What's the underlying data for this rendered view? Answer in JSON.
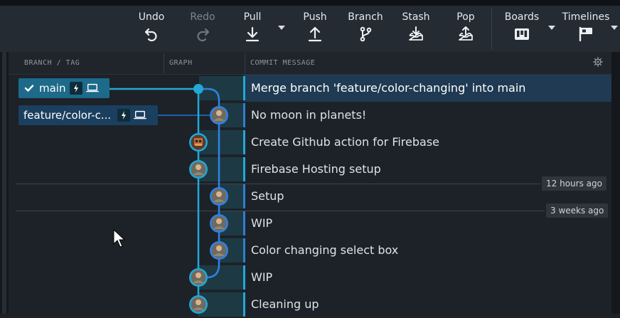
{
  "toolbar": {
    "undo": "Undo",
    "redo": "Redo",
    "pull": "Pull",
    "push": "Push",
    "branch": "Branch",
    "stash": "Stash",
    "pop": "Pop",
    "boards": "Boards",
    "timelines": "Timelines"
  },
  "columns": {
    "branch_tag": "BRANCH / TAG",
    "graph": "GRAPH",
    "commit_message": "COMMIT MESSAGE"
  },
  "branches": {
    "main": "main",
    "feature": "feature/color-c..."
  },
  "commits": [
    {
      "message": "Merge branch 'feature/color-changing' into main"
    },
    {
      "message": "No moon in planets!"
    },
    {
      "message": "Create Github action for Firebase"
    },
    {
      "message": "Firebase Hosting setup"
    },
    {
      "message": "Setup"
    },
    {
      "message": "WIP"
    },
    {
      "message": "Color changing select box"
    },
    {
      "message": "WIP"
    },
    {
      "message": "Cleaning up"
    }
  ],
  "timestamps": {
    "hours": "12 hours ago",
    "weeks": "3 weeks ago"
  },
  "colors": {
    "main_lane": "#22a8d6",
    "feature_lane": "#2f82e6",
    "selected_row": "#1f3a52"
  }
}
